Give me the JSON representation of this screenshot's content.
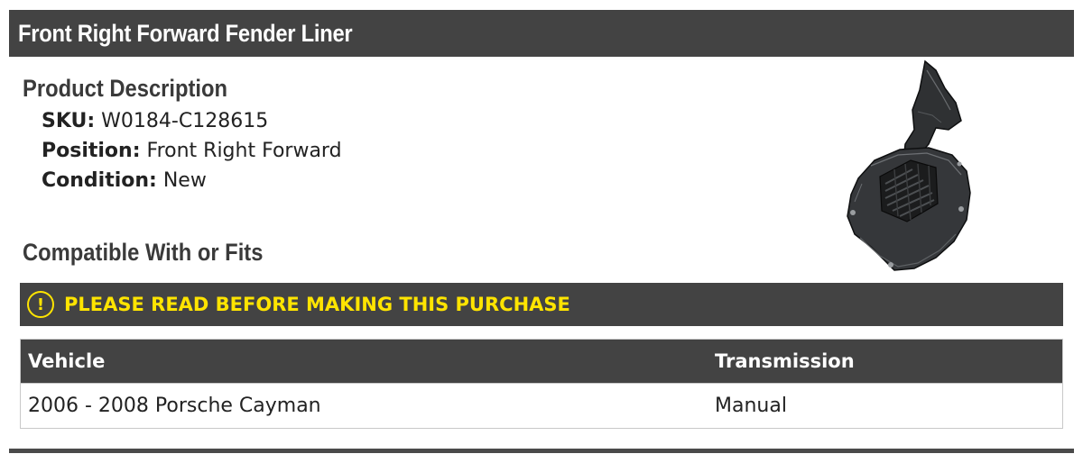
{
  "title": "Front Right Forward Fender Liner",
  "description": {
    "heading": "Product Description",
    "sku": {
      "label": "SKU:",
      "value": "W0184-C128615"
    },
    "position": {
      "label": "Position:",
      "value": "Front Right Forward"
    },
    "condition": {
      "label": "Condition:",
      "value": "New"
    }
  },
  "fits": {
    "heading": "Compatible With or Fits",
    "notice": {
      "icon": "exclamation-circle-icon",
      "text": "PLEASE READ BEFORE MAKING THIS PURCHASE"
    },
    "columns": {
      "vehicle": "Vehicle",
      "transmission": "Transmission"
    },
    "rows": [
      {
        "vehicle": "2006 - 2008 Porsche Cayman",
        "transmission": "Manual"
      }
    ]
  },
  "colors": {
    "bar": "#434343",
    "notice_text": "#ffe400",
    "heading": "#3a3a3a"
  }
}
